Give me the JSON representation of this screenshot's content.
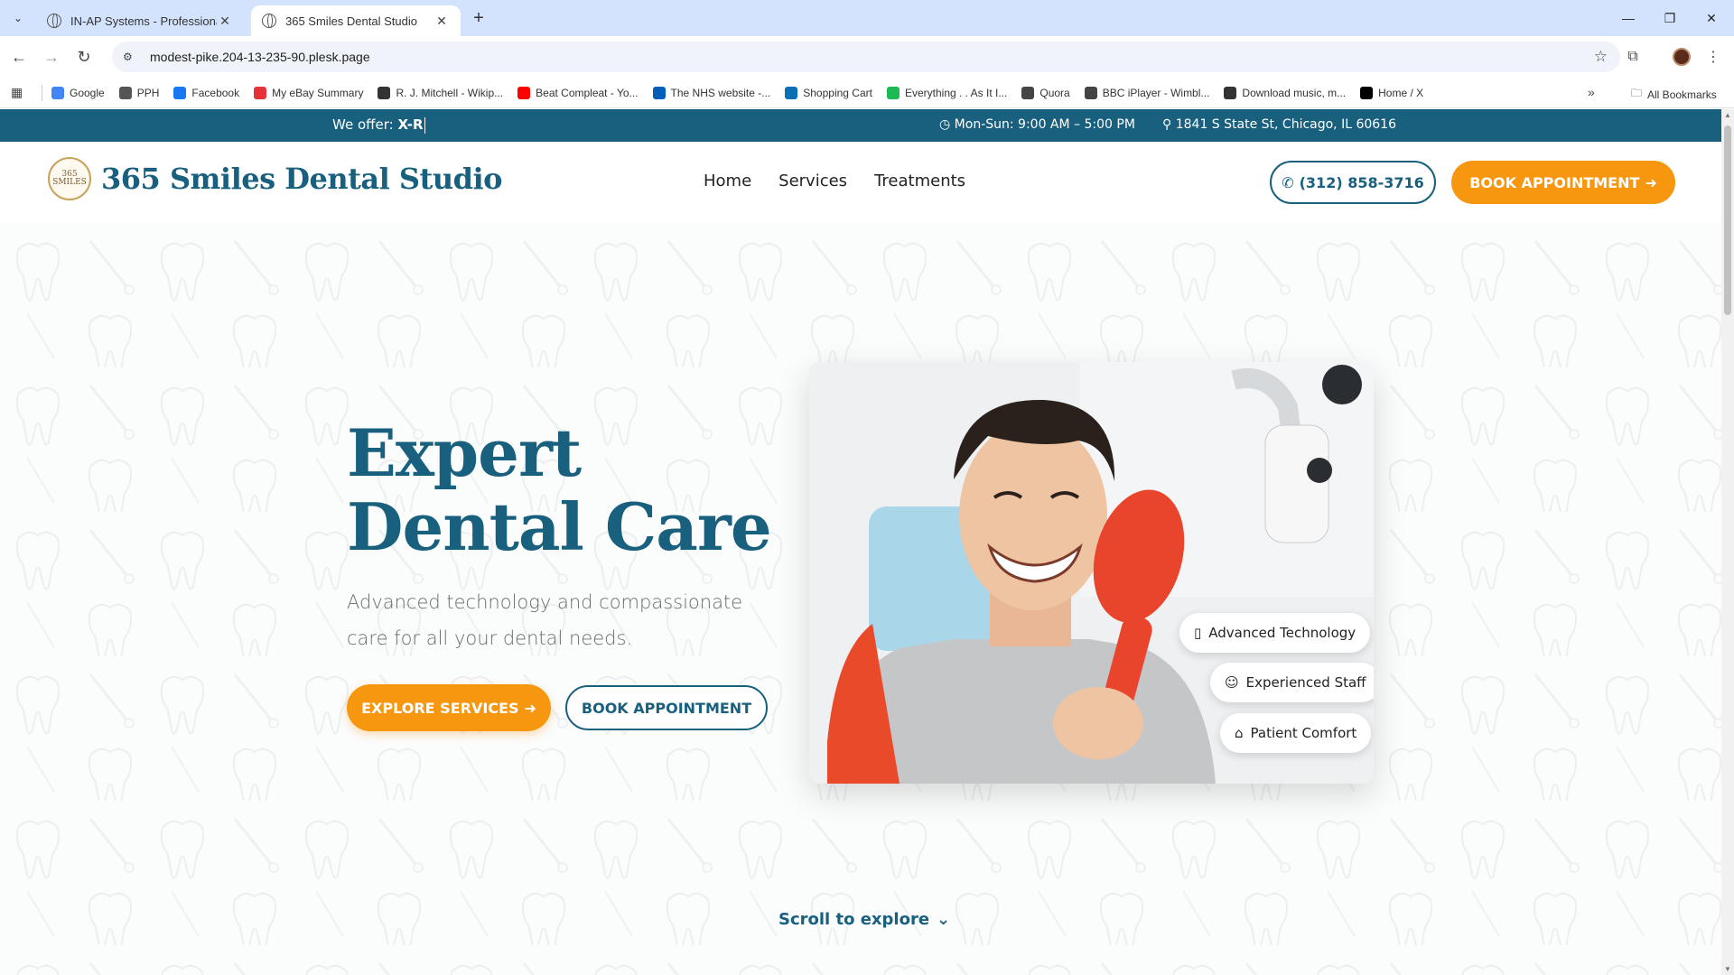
{
  "browser": {
    "tabs": [
      {
        "title": "IN-AP Systems - Professional W",
        "active": false
      },
      {
        "title": "365 Smiles Dental Studio",
        "active": true
      }
    ],
    "address_bar": {
      "url": "modest-pike.204-13-235-90.plesk.page"
    },
    "bookmarks": [
      {
        "label": "Google",
        "icon": "google-icon",
        "color": "#4285f4"
      },
      {
        "label": "PPH",
        "icon": "folder-icon",
        "color": "#555555"
      },
      {
        "label": "Facebook",
        "icon": "facebook-icon",
        "color": "#1877f2"
      },
      {
        "label": "My eBay Summary",
        "icon": "ebay-icon",
        "color": "#e53238"
      },
      {
        "label": "R. J. Mitchell - Wikip...",
        "icon": "wikipedia-icon",
        "color": "#333333"
      },
      {
        "label": "Beat Compleat - Yo...",
        "icon": "youtube-icon",
        "color": "#ff0000"
      },
      {
        "label": "The NHS website -...",
        "icon": "nhs-icon",
        "color": "#005eb8"
      },
      {
        "label": "Shopping Cart",
        "icon": "cart-icon",
        "color": "#0a6fb5"
      },
      {
        "label": "Everything . . As It I...",
        "icon": "spotify-icon",
        "color": "#1db954"
      },
      {
        "label": "Quora",
        "icon": "quora-icon",
        "color": "#444444"
      },
      {
        "label": "BBC iPlayer - Wimbl...",
        "icon": "globe-icon",
        "color": "#444444"
      },
      {
        "label": "Download music, m...",
        "icon": "download-icon",
        "color": "#333333"
      },
      {
        "label": "Home / X",
        "icon": "x-icon",
        "color": "#000000"
      }
    ],
    "all_bookmarks_label": "All Bookmarks"
  },
  "site": {
    "topbar": {
      "offer_prefix": "We offer:",
      "offer_value": "X-R",
      "hours": "Mon-Sun: 9:00 AM – 5:00 PM",
      "address": "1841 S State St, Chicago, IL 60616"
    },
    "logo": {
      "badge_top": "365",
      "badge_mid": "SMILES",
      "name": "365 Smiles Dental Studio"
    },
    "nav": [
      "Home",
      "Services",
      "Treatments"
    ],
    "phone_label": "(312) 858-3716",
    "book_label": "BOOK APPOINTMENT",
    "hero": {
      "title": "Expert Dental Care",
      "subtitle": "Advanced technology and compassionate care for all your dental needs.",
      "explore_label": "EXPLORE SERVICES",
      "book_label": "BOOK APPOINTMENT",
      "features": [
        "Advanced Technology",
        "Experienced Staff",
        "Patient Comfort"
      ]
    },
    "scroll_label": "Scroll to explore",
    "colors": {
      "primary": "#19607e",
      "accent": "#f7960f"
    }
  }
}
